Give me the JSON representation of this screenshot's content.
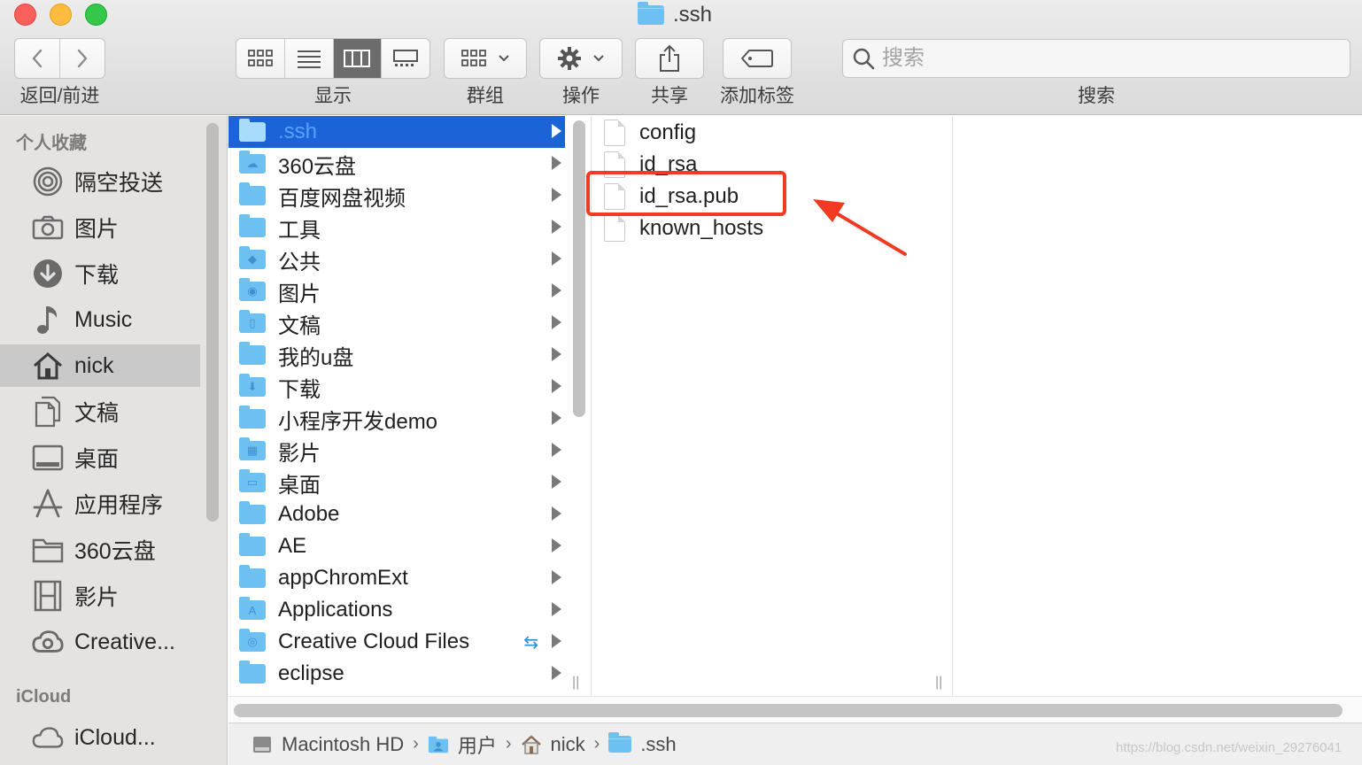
{
  "window": {
    "title": ".ssh",
    "accent_color": "#1b64d8",
    "annotation_color": "#f03a22"
  },
  "toolbar": {
    "nav_label": "返回/前进",
    "view_label": "显示",
    "group_label": "群组",
    "action_label": "操作",
    "share_label": "共享",
    "tags_label": "添加标签",
    "search_label": "搜索",
    "search_placeholder": "搜索",
    "active_view": "columns"
  },
  "sidebar": {
    "favorites_header": "个人收藏",
    "icloud_header": "iCloud",
    "items": [
      {
        "label": "隔空投送",
        "icon": "airdrop-icon"
      },
      {
        "label": "图片",
        "icon": "camera-icon"
      },
      {
        "label": "下载",
        "icon": "download-icon"
      },
      {
        "label": "Music",
        "icon": "music-note-icon"
      },
      {
        "label": "nick",
        "icon": "home-icon"
      },
      {
        "label": "文稿",
        "icon": "documents-icon"
      },
      {
        "label": "桌面",
        "icon": "desktop-icon"
      },
      {
        "label": "应用程序",
        "icon": "applications-icon"
      },
      {
        "label": "360云盘",
        "icon": "folder-icon"
      },
      {
        "label": "影片",
        "icon": "film-icon"
      },
      {
        "label": "Creative...",
        "icon": "creative-cloud-icon"
      }
    ],
    "icloud_items": [
      {
        "label": "iCloud...",
        "icon": "cloud-icon"
      }
    ],
    "selected": "nick"
  },
  "column1": {
    "items": [
      {
        "label": ".ssh"
      },
      {
        "label": "360云盘"
      },
      {
        "label": "百度网盘视频"
      },
      {
        "label": "工具"
      },
      {
        "label": "公共"
      },
      {
        "label": "图片"
      },
      {
        "label": "文稿"
      },
      {
        "label": "我的u盘"
      },
      {
        "label": "下载"
      },
      {
        "label": "小程序开发demo"
      },
      {
        "label": "影片"
      },
      {
        "label": "桌面"
      },
      {
        "label": "Adobe"
      },
      {
        "label": "AE"
      },
      {
        "label": "appChromExt"
      },
      {
        "label": "Applications"
      },
      {
        "label": "Creative Cloud Files"
      },
      {
        "label": "eclipse"
      }
    ],
    "selected": ".ssh"
  },
  "column2": {
    "files": [
      {
        "label": "config"
      },
      {
        "label": "id_rsa"
      },
      {
        "label": "id_rsa.pub"
      },
      {
        "label": "known_hosts"
      }
    ],
    "highlighted": "id_rsa.pub"
  },
  "pathbar": {
    "segments": [
      {
        "label": "Macintosh HD",
        "icon": "hard-drive-icon"
      },
      {
        "label": "用户",
        "icon": "users-folder-icon"
      },
      {
        "label": "nick",
        "icon": "home-icon"
      },
      {
        "label": ".ssh",
        "icon": "folder-icon"
      }
    ]
  },
  "watermark": "https://blog.csdn.net/weixin_29276041"
}
